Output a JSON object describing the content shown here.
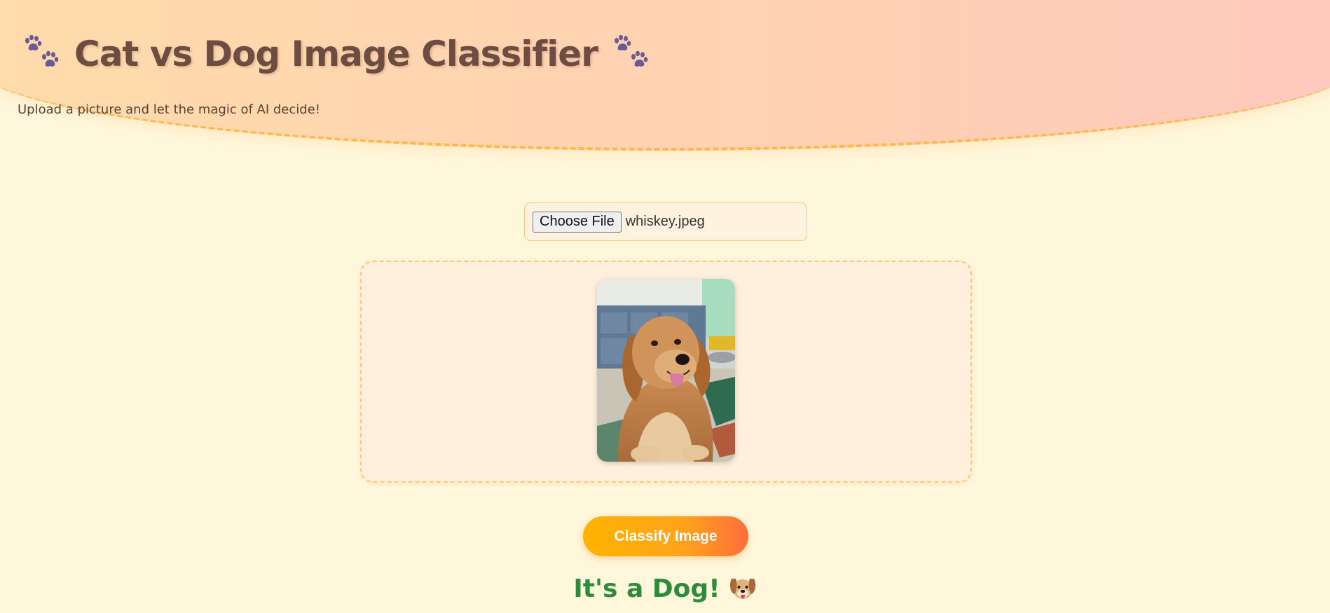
{
  "header": {
    "title": "Cat vs Dog Image Classifier",
    "subtitle": "Upload a picture and let the magic of AI decide!",
    "left_icon": "paw-prints-icon",
    "right_icon": "paw-prints-icon"
  },
  "upload": {
    "button_label": "Choose File",
    "file_name": "whiskey.jpeg"
  },
  "preview": {
    "image_subject": "golden retriever dog photo"
  },
  "actions": {
    "classify_label": "Classify Image"
  },
  "result": {
    "text": "It's a Dog!",
    "icon": "dog-face-icon"
  },
  "colors": {
    "background": "#fff7dc",
    "header_gradient_start": "#ffdcab",
    "header_gradient_end": "#ffc9be",
    "title": "#6d4c41",
    "paw": "#6a5a9a",
    "accent_border": "#ffc970",
    "button_gradient_start": "#ffb300",
    "button_gradient_end": "#ff6d3b",
    "result": "#2e8b3a"
  }
}
